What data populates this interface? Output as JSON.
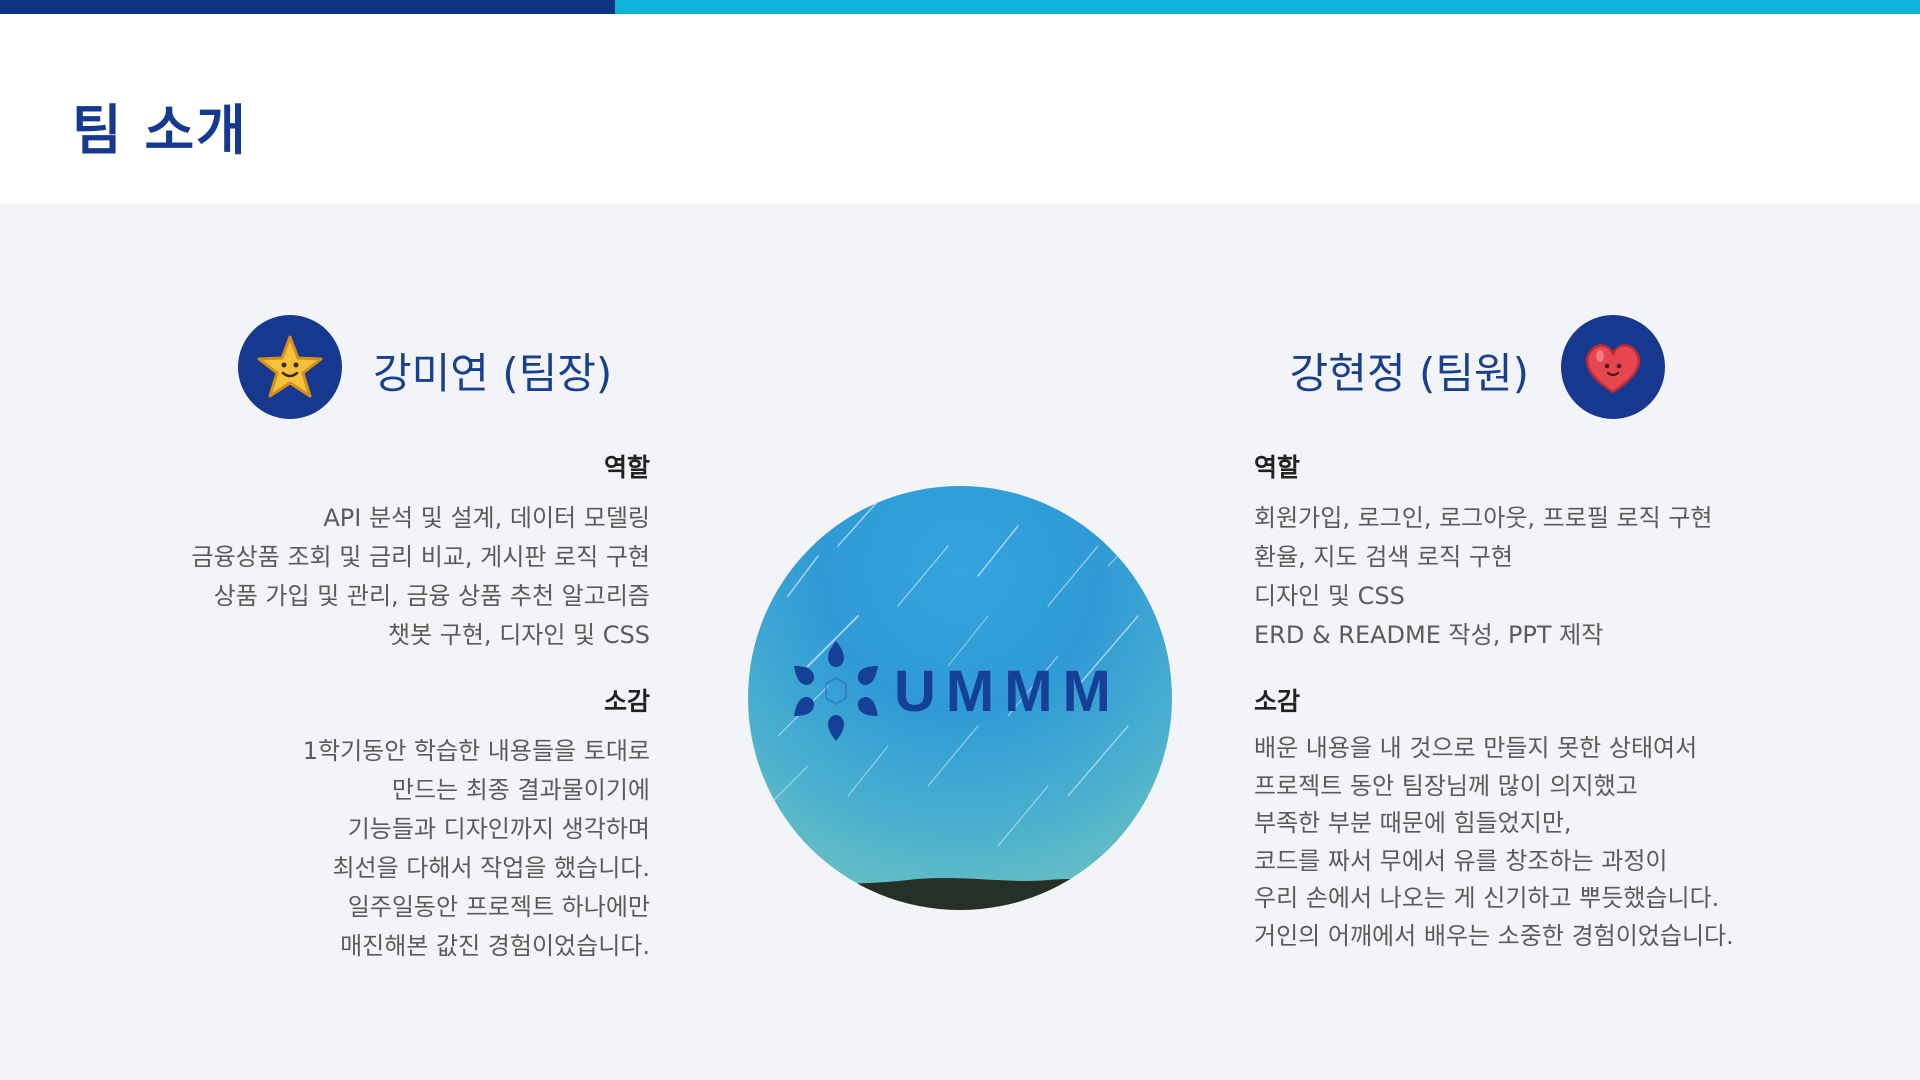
{
  "header": {
    "title": "팀 소개"
  },
  "colors": {
    "primary": "#14398f",
    "accent": "#0fb2db",
    "background": "#f2f4f7"
  },
  "members": [
    {
      "name": "강미연 (팀장)",
      "avatar_icon": "star-icon",
      "role_label": "역할",
      "roles": [
        "API 분석 및 설계, 데이터 모델링",
        "금융상품 조회 및 금리 비교, 게시판 로직 구현",
        "상품 가입 및 관리, 금융 상품 추천 알고리즘",
        "챗봇 구현, 디자인 및 CSS"
      ],
      "review_label": "소감",
      "review": [
        "1학기동안 학습한 내용들을 토대로",
        "만드는 최종 결과물이기에",
        "기능들과 디자인까지 생각하며",
        "최선을 다해서 작업을 했습니다.",
        "일주일동안 프로젝트 하나에만",
        "매진해본 값진 경험이었습니다."
      ]
    },
    {
      "name": "강현정 (팀원)",
      "avatar_icon": "heart-icon",
      "role_label": "역할",
      "roles": [
        "회원가입, 로그인, 로그아웃, 프로필 로직 구현",
        "환율, 지도 검색 로직 구현",
        "디자인 및 CSS",
        "ERD & README 작성, PPT 제작"
      ],
      "review_label": "소감",
      "review": [
        "배운 내용을 내 것으로 만들지 못한 상태여서",
        "프로젝트 동안 팀장님께 많이 의지했고",
        "부족한 부분 때문에 힘들었지만,",
        "코드를 짜서 무에서 유를 창조하는 과정이",
        "우리 손에서 나오는 게 신기하고 뿌듯했습니다.",
        "거인의 어깨에서 배우는 소중한 경험이었습니다."
      ]
    }
  ],
  "logo": {
    "text": "UMMM",
    "icon": "flower-logo-icon"
  }
}
